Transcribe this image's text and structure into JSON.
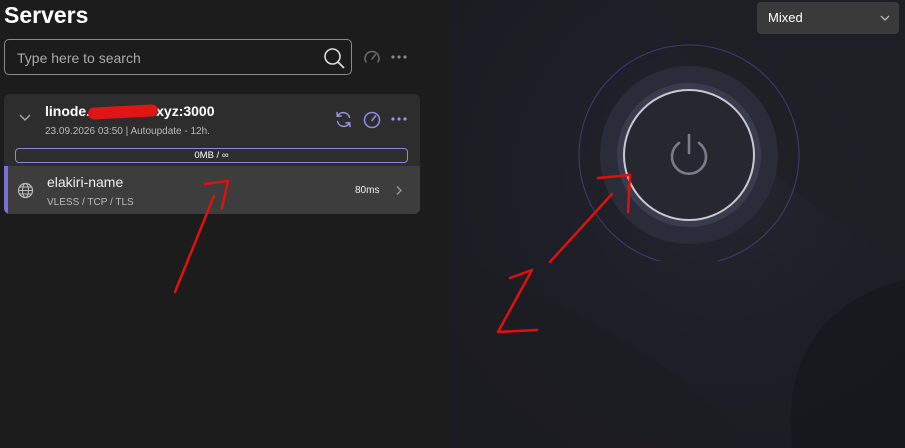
{
  "title": "Servers",
  "search": {
    "placeholder": "Type here to search",
    "value": ""
  },
  "toolbar": {
    "speed_icon": "speedometer-icon",
    "more_icon": "more-icon"
  },
  "group": {
    "name": "linode.",
    "name_suffix": "xyz:3000",
    "meta": "23.09.2026 03:50 | Autoupdate - 12h.",
    "traffic": "0MB / ∞",
    "icons": [
      "chevron-down-icon",
      "refresh-icon",
      "speedometer-icon",
      "more-icon"
    ]
  },
  "server": {
    "name": "elakiri-name",
    "protocol": "VLESS / TCP / TLS",
    "ping": "80ms",
    "icon": "globe-icon"
  },
  "mode": {
    "selected": "Mixed"
  },
  "annotations": {
    "mark_1": "1",
    "mark_2": "2"
  },
  "colors": {
    "accent": "#7b6fd9",
    "annotation": "#e01010",
    "background": "#1c1c1c"
  }
}
